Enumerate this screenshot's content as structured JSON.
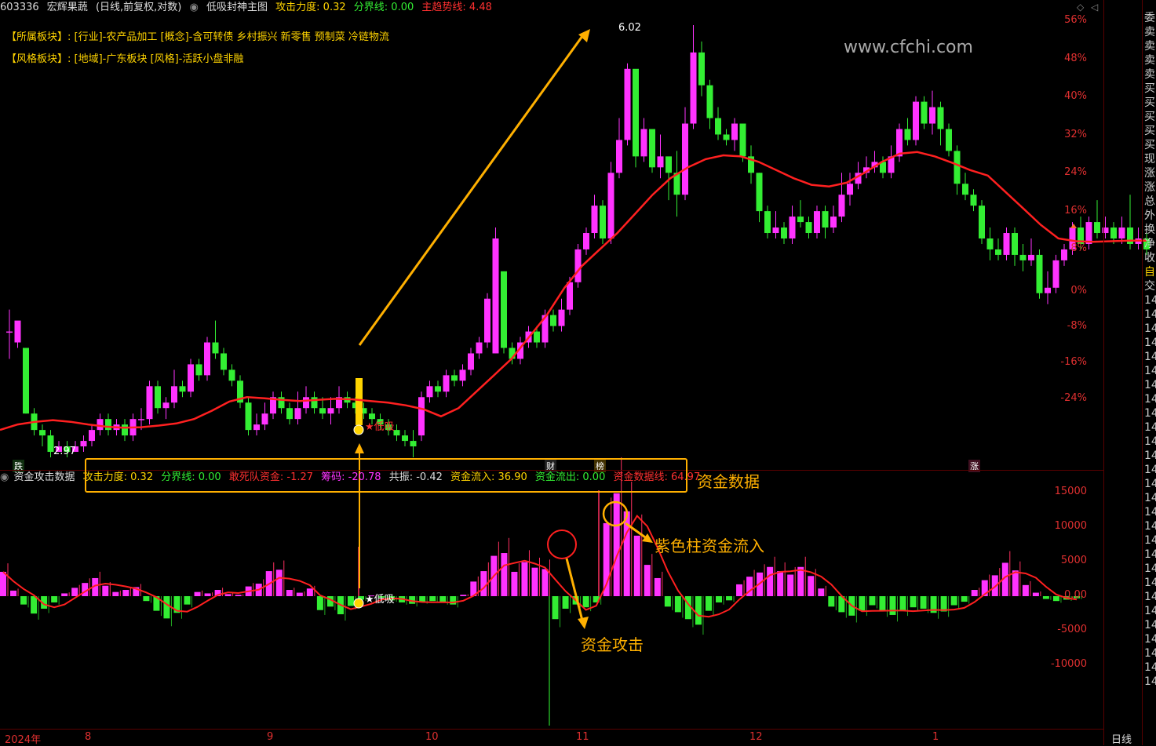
{
  "header": {
    "code": "603336",
    "name": "宏辉果蔬",
    "period": "(日线,前复权,对数)",
    "indicator": "低吸封神主图",
    "attack_label": "攻击力度:",
    "attack_value": "0.32",
    "divide_label": "分界线:",
    "divide_value": "0.00",
    "trend_label": "主趋势线:",
    "trend_value": "4.48"
  },
  "info": {
    "sector_key": "【所属板块】:",
    "sector_val": "[行业]-农产品加工 [概念]-含可转债 乡村振兴 新零售 预制菜 冷链物流",
    "style_key": "【风格板块】:",
    "style_val": "[地域]-广东板块 [风格]-活跃小盘非融"
  },
  "watermark": "www.cfchi.com",
  "price_axis": [
    "56%",
    "48%",
    "40%",
    "32%",
    "24%",
    "16%",
    "8%",
    "0%",
    "-8%",
    "-16%",
    "-24%"
  ],
  "vol_axis": [
    "15000",
    "10000",
    "5000",
    "0.00",
    "-5000",
    "-10000"
  ],
  "marks": {
    "high": "6.02",
    "low": "2.97",
    "dixi": "★低吸",
    "dixi2": "★低吸",
    "die": "跌",
    "cai": "财",
    "bang": "榜",
    "zhang": "涨"
  },
  "sub_header": {
    "name": "资金攻击数据",
    "attack": "攻击力度: 0.32",
    "divide": "分界线: 0.00",
    "dare": "敢死队资金: -1.27",
    "chip": "筹码: -20.78",
    "reso": "共振: -0.42",
    "inflow": "资金流入: 36.90",
    "outflow": "资金流出: 0.00",
    "fundline": "资金数据线: 64.97"
  },
  "annotations": {
    "fund_data": "资金数据",
    "purple_inflow": "紫色柱资金流入",
    "fund_attack": "资金攻击"
  },
  "x_axis": [
    "2024年",
    "8",
    "9",
    "10",
    "11",
    "12",
    "1"
  ],
  "period_button": "日线",
  "right_col": [
    "委",
    "卖",
    "卖",
    "卖",
    "卖",
    "买",
    "买",
    "买",
    "买",
    "买",
    "现",
    "涨",
    "涨",
    "总",
    "外",
    "换",
    "净",
    "收",
    "自",
    "交",
    "14",
    "14",
    "14",
    "14",
    "14",
    "14",
    "14",
    "14",
    "14",
    "14",
    "14",
    "14",
    "14",
    "14",
    "14",
    "14",
    "14",
    "14",
    "14",
    "14",
    "14",
    "14",
    "14",
    "14",
    "14",
    "14",
    "14",
    "14"
  ],
  "colors": {
    "up": "#ff33ff",
    "down": "#33ee33",
    "ma": "#ff2020",
    "accent": "#ffb000",
    "axis": "#e03030"
  },
  "chart_data": {
    "type": "candlestick",
    "title": "低吸封神主图",
    "y_axis": "percent change",
    "ylim": [
      -26,
      58
    ],
    "high_label": 6.02,
    "low_label": 2.97,
    "candles": [
      [
        -1,
        -1,
        3,
        -6
      ],
      [
        -3,
        1,
        -3,
        -4
      ],
      [
        -4,
        -16,
        -4,
        -16
      ],
      [
        -16,
        -19,
        -15,
        -20
      ],
      [
        -19,
        -20,
        -18,
        -22
      ],
      [
        -20,
        -23,
        -19,
        -24
      ],
      [
        -23,
        -22,
        -21,
        -23
      ],
      [
        -22,
        -23,
        -21,
        -24
      ],
      [
        -23,
        -22,
        -21,
        -23
      ],
      [
        -22,
        -21,
        -20,
        -23
      ],
      [
        -21,
        -19,
        -18,
        -22
      ],
      [
        -19,
        -17,
        -16,
        -20
      ],
      [
        -17,
        -19,
        -16,
        -20
      ],
      [
        -19,
        -18,
        -17,
        -20
      ],
      [
        -18,
        -20,
        -17,
        -21
      ],
      [
        -20,
        -17,
        -16,
        -21
      ],
      [
        -17,
        -17,
        -15,
        -19
      ],
      [
        -17,
        -11,
        -10,
        -18
      ],
      [
        -11,
        -15,
        -10,
        -16
      ],
      [
        -15,
        -14,
        -13,
        -17
      ],
      [
        -14,
        -11,
        -8,
        -15
      ],
      [
        -11,
        -12,
        -10,
        -13
      ],
      [
        -12,
        -7,
        -6,
        -13
      ],
      [
        -7,
        -9,
        -6,
        -10
      ],
      [
        -9,
        -3,
        -2,
        -10
      ],
      [
        -3,
        -5,
        1,
        -6
      ],
      [
        -5,
        -8,
        -4,
        -9
      ],
      [
        -8,
        -10,
        -7,
        -11
      ],
      [
        -10,
        -14,
        -9,
        -15
      ],
      [
        -14,
        -19,
        -13,
        -20
      ],
      [
        -19,
        -18,
        -16,
        -20
      ],
      [
        -18,
        -16,
        -14,
        -19
      ],
      [
        -16,
        -13,
        -12,
        -17
      ],
      [
        -13,
        -15,
        -12,
        -16
      ],
      [
        -15,
        -17,
        -14,
        -18
      ],
      [
        -17,
        -15,
        -12,
        -18
      ],
      [
        -15,
        -13,
        -11,
        -16
      ],
      [
        -13,
        -15,
        -12,
        -16
      ],
      [
        -15,
        -16,
        -13,
        -17
      ],
      [
        -16,
        -15,
        -13,
        -18
      ],
      [
        -15,
        -13,
        -11,
        -16
      ],
      [
        -13,
        -14,
        -12,
        -15
      ],
      [
        -14,
        -15,
        -13,
        -16
      ],
      [
        -15,
        -16,
        -14,
        -17
      ],
      [
        -16,
        -17,
        -15,
        -18
      ],
      [
        -17,
        -18,
        -16,
        -19
      ],
      [
        -18,
        -19,
        -17,
        -20
      ],
      [
        -19,
        -20,
        -18,
        -21
      ],
      [
        -20,
        -21,
        -19,
        -22
      ],
      [
        -21,
        -22,
        -19,
        -24
      ],
      [
        -20,
        -13,
        -12,
        -21
      ],
      [
        -13,
        -11,
        -10,
        -14
      ],
      [
        -11,
        -12,
        -10,
        -13
      ],
      [
        -12,
        -9,
        -8,
        -13
      ],
      [
        -9,
        -10,
        -8,
        -11
      ],
      [
        -10,
        -8,
        -7,
        -11
      ],
      [
        -8,
        -5,
        -4,
        -9
      ],
      [
        -5,
        -3,
        -2,
        -6
      ],
      [
        -3,
        5,
        6,
        -4
      ],
      [
        -5,
        16,
        18,
        -5
      ],
      [
        10,
        -4,
        -2,
        -5
      ],
      [
        -4,
        -6,
        -3,
        -7
      ],
      [
        -6,
        -3,
        -2,
        -7
      ],
      [
        -3,
        -1,
        0,
        -4
      ],
      [
        -1,
        -3,
        0,
        -4
      ],
      [
        -3,
        2,
        3,
        -4
      ],
      [
        2,
        0,
        3,
        -1
      ],
      [
        0,
        3,
        5,
        -1
      ],
      [
        3,
        8,
        9,
        2
      ],
      [
        8,
        14,
        15,
        7
      ],
      [
        14,
        17,
        18,
        13
      ],
      [
        17,
        22,
        24,
        16
      ],
      [
        22,
        16,
        23,
        15
      ],
      [
        16,
        28,
        30,
        15
      ],
      [
        28,
        34,
        38,
        27
      ],
      [
        34,
        47,
        48,
        33
      ],
      [
        47,
        31,
        40,
        29
      ],
      [
        31,
        36,
        38,
        30
      ],
      [
        36,
        29,
        32,
        28
      ],
      [
        29,
        31,
        35,
        27
      ],
      [
        31,
        28,
        30,
        23
      ],
      [
        28,
        24,
        32,
        20
      ],
      [
        24,
        37,
        40,
        23
      ],
      [
        37,
        50,
        55,
        36
      ],
      [
        50,
        44,
        52,
        42
      ],
      [
        44,
        38,
        45,
        36
      ],
      [
        38,
        35,
        40,
        34
      ],
      [
        35,
        34,
        36,
        33
      ],
      [
        34,
        37,
        38,
        32
      ],
      [
        37,
        31,
        36,
        30
      ],
      [
        31,
        28,
        33,
        26
      ],
      [
        28,
        21,
        28,
        19
      ],
      [
        21,
        17,
        22,
        16
      ],
      [
        17,
        18,
        21,
        16
      ],
      [
        18,
        16,
        19,
        15
      ],
      [
        16,
        20,
        22,
        15
      ],
      [
        20,
        19,
        23,
        18
      ],
      [
        19,
        17,
        20,
        16
      ],
      [
        17,
        21,
        22,
        16
      ],
      [
        21,
        18,
        22,
        16
      ],
      [
        18,
        20,
        22,
        17
      ],
      [
        20,
        24,
        28,
        19
      ],
      [
        24,
        26,
        28,
        22
      ],
      [
        26,
        28,
        30,
        25
      ],
      [
        28,
        29,
        31,
        27
      ],
      [
        29,
        30,
        32,
        28
      ],
      [
        30,
        28,
        31,
        27
      ],
      [
        28,
        31,
        33,
        27
      ],
      [
        31,
        36,
        37,
        30
      ],
      [
        36,
        34,
        38,
        33
      ],
      [
        34,
        41,
        42,
        33
      ],
      [
        41,
        37,
        42,
        36
      ],
      [
        37,
        40,
        43,
        35
      ],
      [
        40,
        36,
        41,
        33
      ],
      [
        36,
        32,
        37,
        31
      ],
      [
        32,
        26,
        33,
        24
      ],
      [
        26,
        24,
        28,
        23
      ],
      [
        24,
        22,
        25,
        21
      ],
      [
        22,
        16,
        23,
        15
      ],
      [
        16,
        14,
        18,
        12
      ],
      [
        14,
        13,
        16,
        12
      ],
      [
        13,
        17,
        18,
        12
      ],
      [
        17,
        13,
        18,
        11
      ],
      [
        13,
        12,
        15,
        10
      ],
      [
        12,
        13,
        16,
        11
      ],
      [
        13,
        6,
        14,
        5
      ],
      [
        6,
        7,
        10,
        4
      ],
      [
        7,
        12,
        13,
        6
      ],
      [
        12,
        14,
        15,
        11
      ],
      [
        14,
        18,
        19,
        13
      ],
      [
        18,
        15,
        20,
        14
      ],
      [
        15,
        19,
        20,
        14
      ],
      [
        19,
        17,
        23,
        16
      ],
      [
        17,
        18,
        20,
        16
      ],
      [
        18,
        16,
        19,
        15
      ],
      [
        16,
        18,
        20,
        15
      ],
      [
        18,
        15,
        24,
        14
      ],
      [
        15,
        16,
        18,
        14
      ],
      [
        16,
        14,
        17,
        13
      ]
    ],
    "ma": [
      -19,
      -18,
      -17.5,
      -17.2,
      -17.5,
      -18,
      -18.4,
      -18.6,
      -18.5,
      -18.2,
      -17.8,
      -17,
      -15.5,
      -13.8,
      -13,
      -13.2,
      -13.5,
      -13.7,
      -13.5,
      -13.3,
      -13.4,
      -13.7,
      -14,
      -14.5,
      -15.2,
      -16.5,
      -15,
      -12,
      -9,
      -6,
      -2,
      2,
      7,
      11,
      14,
      17,
      20.5,
      24,
      27,
      29,
      30.5,
      31.2,
      31,
      30,
      28.5,
      27,
      25.8,
      25.5,
      26.2,
      28,
      30,
      31.5,
      31.8,
      31,
      29.8,
      28.5,
      27.5,
      24.5,
      21.5,
      18.5,
      16,
      15.5,
      15.4,
      15.5,
      15.6,
      15.6
    ],
    "vol": [
      3500,
      800,
      -1200,
      -2500,
      -1800,
      -900,
      400,
      1200,
      1900,
      2600,
      1500,
      600,
      900,
      1300,
      -700,
      -2100,
      -3200,
      -2400,
      -1200,
      600,
      400,
      900,
      300,
      200,
      1400,
      1800,
      3600,
      3800,
      900,
      500,
      1100,
      -2000,
      -1500,
      -2600,
      -1400,
      -500,
      100,
      -200,
      -600,
      -900,
      -1100,
      -800,
      -700,
      -900,
      -1200,
      200,
      2100,
      3600,
      5800,
      6200,
      3500,
      4900,
      4100,
      3900,
      -3300,
      -1800,
      -1200,
      -1600,
      -900,
      10500,
      14800,
      12200,
      8700,
      4500,
      2600,
      -1500,
      -2300,
      -3300,
      -4100,
      -2100,
      -900,
      -600,
      1700,
      2800,
      3400,
      4200,
      3600,
      3100,
      4200,
      2900,
      1100,
      -1500,
      -2300,
      -2800,
      -2100,
      -1300,
      -2200,
      -2700,
      -2100,
      -1600,
      -1800,
      -2400,
      -2200,
      -1300,
      -800,
      900,
      2300,
      3000,
      4800,
      3700,
      1600,
      500,
      -400,
      -700,
      -500,
      -300
    ]
  }
}
